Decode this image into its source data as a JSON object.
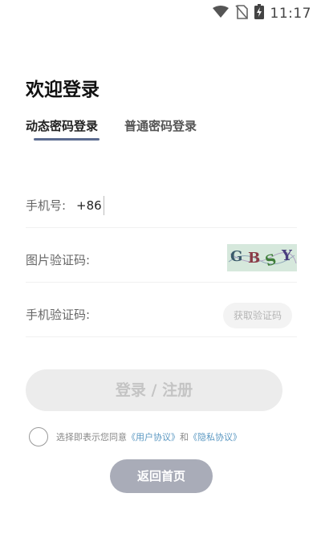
{
  "status_bar": {
    "time": "11:17",
    "icons": [
      "wifi-icon",
      "no-sim-icon",
      "battery-charging-icon"
    ]
  },
  "page": {
    "title": "欢迎登录"
  },
  "tabs": [
    {
      "label": "动态密码登录",
      "active": true
    },
    {
      "label": "普通密码登录",
      "active": false
    }
  ],
  "form": {
    "phone": {
      "label": "手机号:",
      "prefix": "+86",
      "value": ""
    },
    "captcha": {
      "label": "图片验证码:",
      "value": "",
      "image_text": [
        "G",
        "B",
        "S",
        "Y"
      ]
    },
    "sms_code": {
      "label": "手机验证码:",
      "value": "",
      "button": "获取验证码"
    }
  },
  "login_button": "登录 / 注册",
  "agreement": {
    "prefix": "选择即表示您同意",
    "user_link": "《用户协议》",
    "and": "和",
    "privacy_link": "《隐私协议》",
    "checked": false
  },
  "home_button": "返回首页",
  "colors": {
    "tab_underline": "#5b6b8f",
    "link": "#5b98c2",
    "home_button": "#a9acb8",
    "login_button": "#ececec"
  }
}
